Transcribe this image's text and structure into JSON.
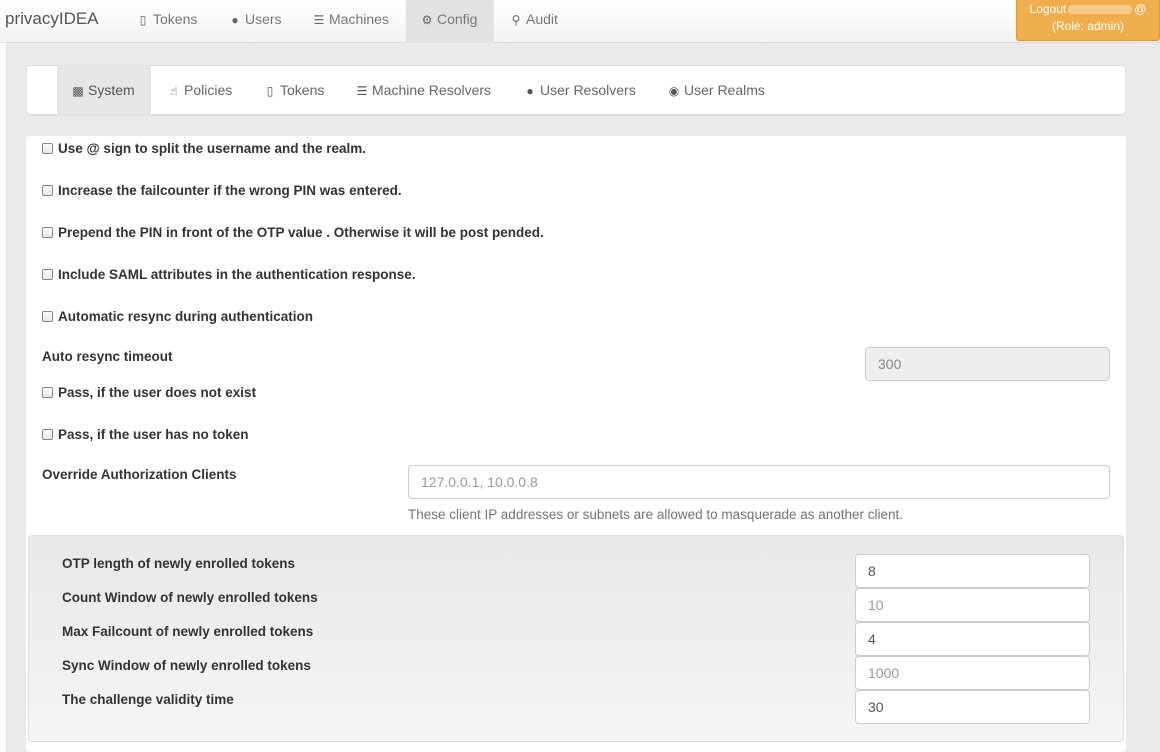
{
  "brand": "privacyIDEA",
  "nav": [
    {
      "label": "Tokens",
      "icon": "mobile-icon"
    },
    {
      "label": "Users",
      "icon": "user-icon"
    },
    {
      "label": "Machines",
      "icon": "server-icon"
    },
    {
      "label": "Config",
      "icon": "cog-icon"
    },
    {
      "label": "Audit",
      "icon": "search-icon"
    }
  ],
  "logout": {
    "line1": "Logout",
    "at": "@",
    "line2": "(Role: admin)"
  },
  "subnav": [
    {
      "label": "System",
      "icon": "briefcase-icon"
    },
    {
      "label": "Policies",
      "icon": "hand-pointer-icon"
    },
    {
      "label": "Tokens",
      "icon": "mobile-icon"
    },
    {
      "label": "Machine Resolvers",
      "icon": "server-icon"
    },
    {
      "label": "User Resolvers",
      "icon": "user-icon"
    },
    {
      "label": "User Realms",
      "icon": "globe-icon"
    }
  ],
  "settings": {
    "split_at": "Use @ sign to split the username and the realm.",
    "failcounter": "Increase the failcounter if the wrong PIN was entered.",
    "prepend_pin": "Prepend the PIN in front of the OTP value . Otherwise it will be post pended.",
    "saml": "Include SAML attributes in the authentication response.",
    "auto_resync": "Automatic resync during authentication",
    "auto_resync_timeout_label": "Auto resync timeout",
    "auto_resync_timeout_value": "300",
    "pass_no_user": "Pass, if the user does not exist",
    "pass_no_token": "Pass, if the user has no token",
    "override_label": "Override Authorization Clients",
    "override_placeholder": "127.0.0.1, 10.0.0.8",
    "override_help": "These client IP addresses or subnets are allowed to masquerade as another client."
  },
  "defaults": {
    "otp_length_label": "OTP length of newly enrolled tokens",
    "otp_length_value": "8",
    "count_window_label": "Count Window of newly enrolled tokens",
    "count_window_placeholder": "10",
    "max_fail_label": "Max Failcount of newly enrolled tokens",
    "max_fail_value": "4",
    "sync_window_label": "Sync Window of newly enrolled tokens",
    "sync_window_placeholder": "1000",
    "challenge_label": "The challenge validity time",
    "challenge_value": "30"
  },
  "colors": {
    "logout_bg": "#f0ad4e",
    "active_tab": "#e2e2e2"
  }
}
